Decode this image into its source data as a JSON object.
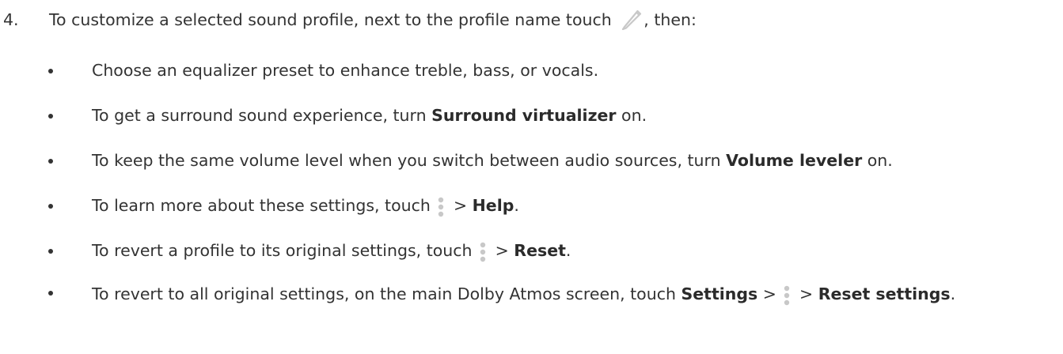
{
  "step": {
    "number": "4.",
    "text_before_icon": "To customize a selected sound profile, next to the profile name touch ",
    "icon": "pencil-icon",
    "text_after_icon": ", then:"
  },
  "bullets": [
    {
      "text": "Choose an equalizer preset to enhance treble, bass, or vocals."
    },
    {
      "before": "To get a surround sound experience, turn ",
      "bold": "Surround virtualizer",
      "after": " on."
    },
    {
      "before": "To keep the same volume level when you switch between audio sources, turn ",
      "bold": "Volume leveler",
      "after": " on."
    },
    {
      "before": "To learn more about these settings, touch ",
      "icon": "more-vertical-icon",
      "sep": " > ",
      "bold": "Help",
      "after": "."
    },
    {
      "before": "To revert a profile to its original settings, touch ",
      "icon": "more-vertical-icon",
      "sep": " > ",
      "bold": "Reset",
      "after": "."
    },
    {
      "before": "To revert to all original settings, on the main Dolby Atmos screen, touch ",
      "bold1": "Settings",
      "sep1": " > ",
      "icon": "more-vertical-icon",
      "sep2": " > ",
      "bold2": "Reset settings",
      "after": "."
    }
  ],
  "colors": {
    "text": "#333333",
    "icon": "#c8c8c8"
  }
}
